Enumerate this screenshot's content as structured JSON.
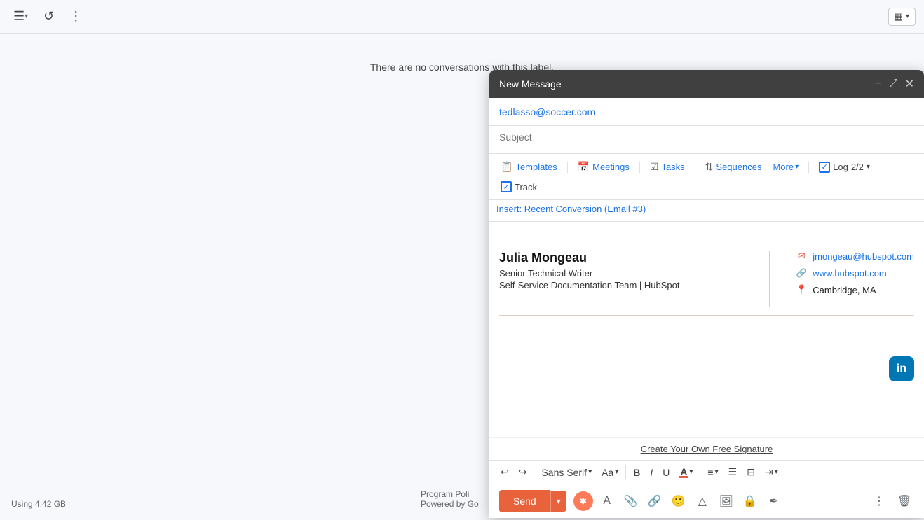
{
  "app": {
    "empty_message": "There are no conversations with this label."
  },
  "toolbar": {
    "layout_label": "▦",
    "more_options": "⋮",
    "refresh": "↺"
  },
  "footer": {
    "storage": "Using 4.42 GB",
    "program_policy": "Program Poli",
    "powered_by": "Powered by Go"
  },
  "compose": {
    "title": "New Message",
    "to": "tedlasso@soccer.com",
    "subject_placeholder": "Subject",
    "toolbar": {
      "templates": "Templates",
      "meetings": "Meetings",
      "tasks": "Tasks",
      "sequences": "Sequences",
      "more": "More",
      "log": "Log",
      "log_count": "2/2",
      "track": "Track"
    },
    "insert_suggestion": "Insert: Recent Conversion (Email #3)",
    "signature": {
      "divider": "--",
      "name": "Julia Mongeau",
      "title": "Senior Technical Writer",
      "org": "Self-Service Documentation Team | HubSpot",
      "email": "jmongeau@hubspot.com",
      "website": "www.hubspot.com",
      "location": "Cambridge, MA"
    },
    "create_signature": "Create Your Own Free Signature",
    "format": {
      "undo": "↩",
      "redo": "↪",
      "font": "Sans Serif",
      "font_size": "Aa",
      "bold": "B",
      "italic": "I",
      "underline": "U",
      "font_color": "A",
      "align": "≡",
      "bullet_list": "≔",
      "numbered_list": "⊟",
      "indent": "⇥",
      "more_format": "▾"
    },
    "send": {
      "label": "Send",
      "arrow": "▾",
      "more_icon": "⋮",
      "trash_icon": "🗑"
    }
  }
}
